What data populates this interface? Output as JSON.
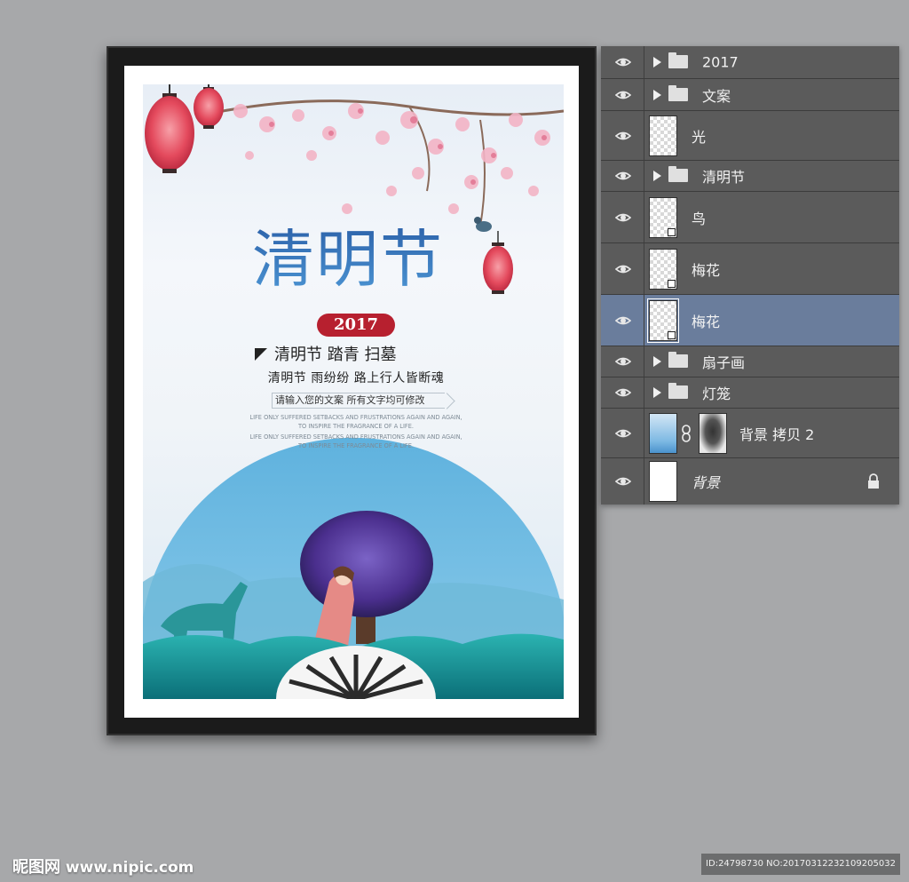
{
  "poster": {
    "title": "清明节",
    "year": "2017",
    "tagline": "清明节 踏青 扫墓",
    "poem": "清明节  雨纷纷  路上行人皆断魂",
    "input_text": "请输入您的文案 所有文字均可修改",
    "english_lines": [
      "LIFE ONLY SUFFERED SETBACKS AND FRUSTRATIONS AGAIN AND AGAIN,",
      "TO INSPIRE THE FRAGRANCE OF A LIFE.",
      "LIFE ONLY SUFFERED SETBACKS AND FRUSTRATIONS AGAIN AND AGAIN,",
      "TO INSPIRE THE FRAGRANCE OF A LIFE."
    ]
  },
  "layers": [
    {
      "name": "2017",
      "type": "group",
      "selected": false
    },
    {
      "name": "文案",
      "type": "group",
      "selected": false
    },
    {
      "name": "光",
      "type": "layer",
      "selected": false
    },
    {
      "name": "清明节",
      "type": "group",
      "selected": false
    },
    {
      "name": "鸟",
      "type": "layer",
      "selected": false
    },
    {
      "name": "梅花",
      "type": "layer",
      "selected": false
    },
    {
      "name": "梅花",
      "type": "layer",
      "selected": true
    },
    {
      "name": "扇子画",
      "type": "group",
      "selected": false
    },
    {
      "name": "灯笼",
      "type": "group",
      "selected": false
    },
    {
      "name": "背景 拷贝 2",
      "type": "masked-layer",
      "selected": false
    },
    {
      "name": "背景",
      "type": "background",
      "locked": true,
      "selected": false
    }
  ],
  "footer": {
    "brand": "昵图网",
    "url": "www.nipic.com",
    "image_id": "ID:24798730 NO:20170312232109205032"
  },
  "colors": {
    "canvas": "#a7a8aa",
    "panel": "#5b5b5b",
    "selected_row": "#6a7d9c",
    "title_blue": "#2f73b8",
    "year_red": "#b7202f"
  }
}
